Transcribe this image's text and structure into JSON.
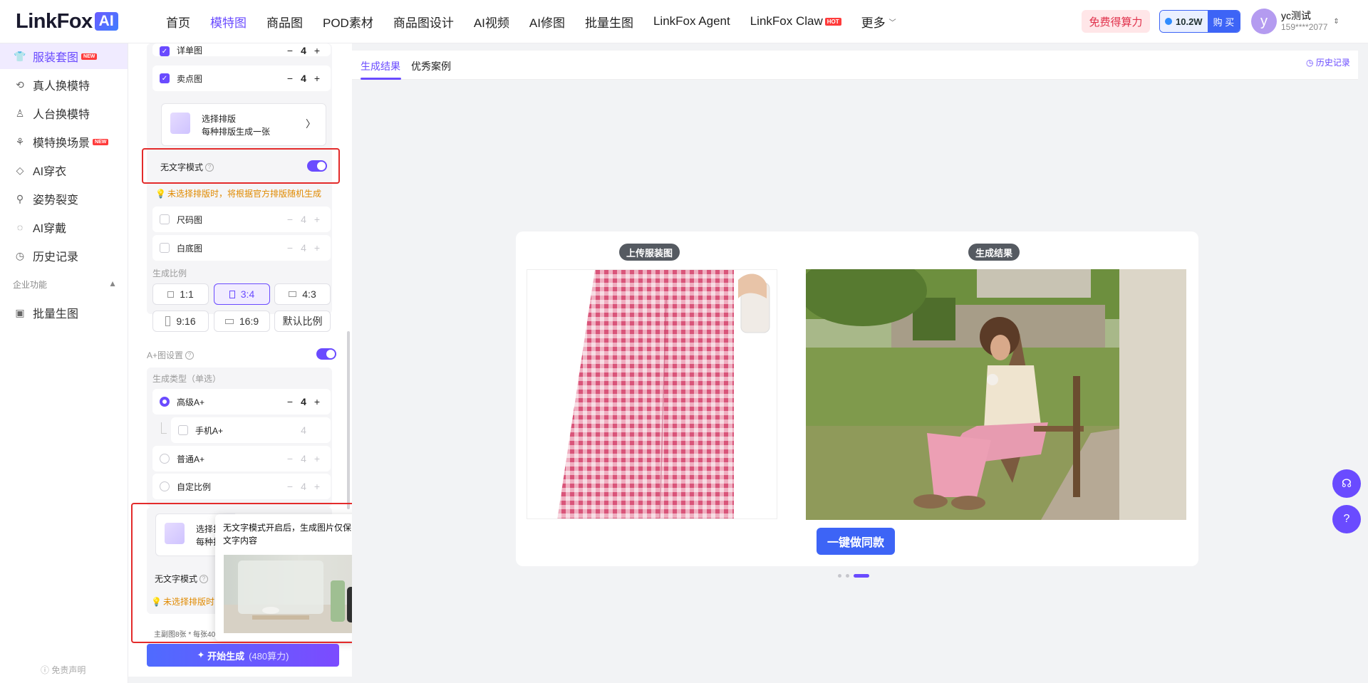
{
  "header": {
    "logo_text": "LinkFox",
    "logo_badge": "AI",
    "nav": [
      {
        "label": "首页",
        "active": false
      },
      {
        "label": "模特图",
        "active": true
      },
      {
        "label": "商品图",
        "active": false
      },
      {
        "label": "POD素材",
        "active": false
      },
      {
        "label": "商品图设计",
        "active": false
      },
      {
        "label": "AI视频",
        "active": false
      },
      {
        "label": "AI修图",
        "active": false
      },
      {
        "label": "批量生图",
        "active": false
      },
      {
        "label": "LinkFox Agent",
        "active": false
      },
      {
        "label": "LinkFox Claw",
        "active": false,
        "badge": "HOT"
      },
      {
        "label": "更多",
        "active": false
      }
    ],
    "free_credit": "免费得算力",
    "credit_value": "10.2W",
    "buy_label": "购 买",
    "avatar_letter": "y",
    "user_name": "yc测试",
    "user_phone": "159****2077"
  },
  "sidebar": {
    "items": [
      {
        "label": "服装套图",
        "icon": "shirt-icon",
        "badge": "NEW",
        "active": true
      },
      {
        "label": "真人换模特",
        "icon": "person-swap-icon"
      },
      {
        "label": "人台换模特",
        "icon": "mannequin-icon"
      },
      {
        "label": "模特换场景",
        "icon": "scene-icon",
        "badge": "NEW"
      },
      {
        "label": "AI穿衣",
        "icon": "clothing-icon"
      },
      {
        "label": "姿势裂变",
        "icon": "pose-icon"
      },
      {
        "label": "AI穿戴",
        "icon": "accessory-icon"
      },
      {
        "label": "历史记录",
        "icon": "history-icon"
      }
    ],
    "group_label": "企业功能",
    "group_items": [
      {
        "label": "批量生图",
        "icon": "image-batch-icon"
      }
    ],
    "disclaimer": "免责声明"
  },
  "panel": {
    "row_top_label": "详单图",
    "row_top_count": "4",
    "selling_label": "卖点图",
    "selling_count": "4",
    "layout_title": "选择排版",
    "layout_sub": "每种排版生成一张",
    "no_text_label": "无文字模式",
    "tip": "未选择排版时，将根据官方排版随机生成",
    "size_label": "尺码图",
    "size_count": "4",
    "white_label": "白底图",
    "white_count": "4",
    "ratio_label": "生成比例",
    "ratios": [
      "1:1",
      "3:4",
      "4:3",
      "9:16",
      "16:9",
      "默认比例"
    ],
    "selected_ratio": "3:4",
    "aplus_label": "A+图设置",
    "gen_type_label": "生成类型（单选）",
    "aplus_high": "高级A+",
    "aplus_high_count": "4",
    "mobile_aplus": "手机A+",
    "mobile_aplus_count": "4",
    "normal_aplus": "普通A+",
    "normal_aplus_count": "4",
    "custom_ratio": "自定比例",
    "custom_ratio_count": "4",
    "layout2_title": "选择排",
    "layout2_sub": "每种排",
    "no_text_label2": "无文字模式",
    "tip2": "未选择排版时,",
    "footnote": "主副图8张 * 每张40",
    "generate_label": "开始生成",
    "generate_cost": "(480算力)"
  },
  "popover": {
    "text": "无文字模式开启后，生成图片仅保留排版，不包含文字内容"
  },
  "main": {
    "tabs": [
      {
        "label": "生成结果",
        "active": true
      },
      {
        "label": "优秀案例",
        "active": false
      }
    ],
    "history_label": "历史记录",
    "upload_label": "上传服装图",
    "result_label": "生成结果",
    "same_button": "一键做同款"
  }
}
